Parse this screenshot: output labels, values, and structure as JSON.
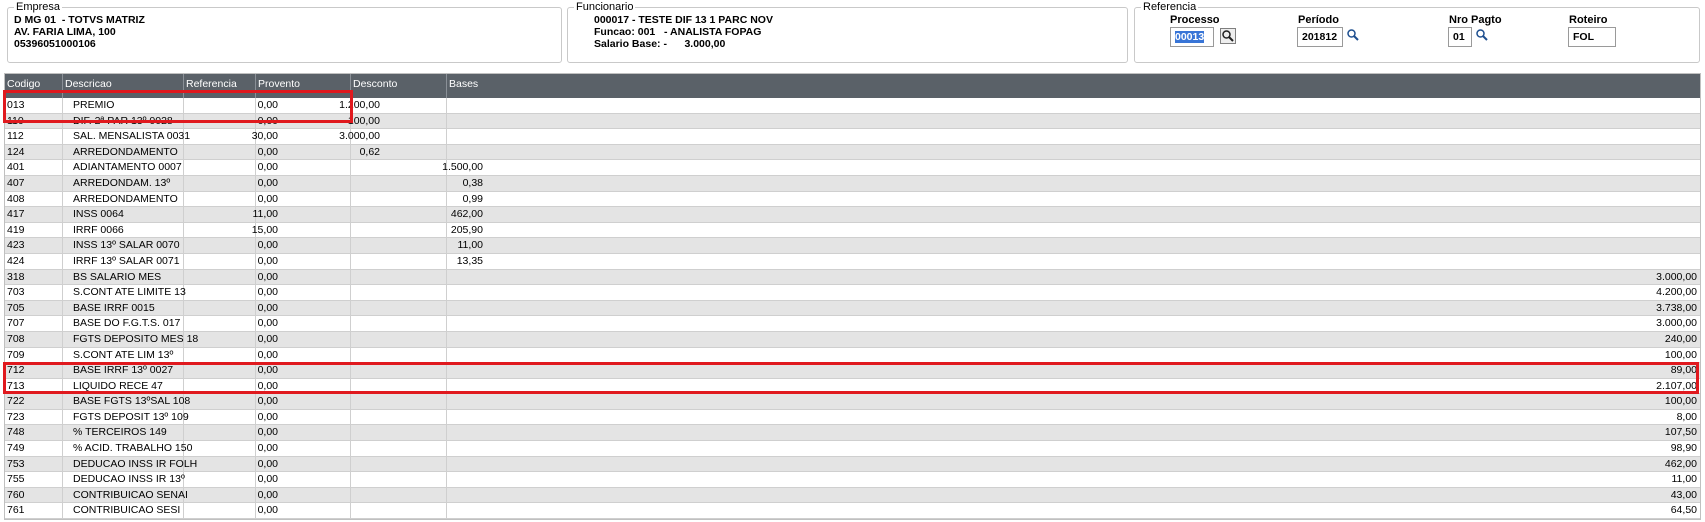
{
  "empresa": {
    "title": "Empresa",
    "line1": "D MG 01  - TOTVS MATRIZ",
    "line2": "AV. FARIA LIMA, 100",
    "line3": "05396051000106"
  },
  "funcionario": {
    "title": "Funcionario",
    "line1": "000017 - TESTE DIF 13 1 PARC NOV",
    "line2": "Funcao: 001   - ANALISTA FOPAG",
    "line3": "Salario Base: -      3.000,00"
  },
  "referencia": {
    "title": "Referencia",
    "processo_label": "Processo",
    "processo_value": "00013",
    "periodo_label": "Período",
    "periodo_value": "201812",
    "nro_pagto_label": "Nro Pagto",
    "nro_pagto_value": "01",
    "roteiro_label": "Roteiro",
    "roteiro_value": "FOL"
  },
  "table": {
    "headers": [
      "Codigo",
      "Descricao",
      "Referencia",
      "Provento",
      "Desconto",
      "Bases"
    ],
    "rows": [
      {
        "codigo": "013",
        "descricao": "PREMIO",
        "referencia": "0,00",
        "provento": "1.200,00",
        "desconto": "",
        "bases": ""
      },
      {
        "codigo": "110",
        "descricao": "DIF. 2ª PAR 13º 0028",
        "referencia": "0,00",
        "provento": "100,00",
        "desconto": "",
        "bases": ""
      },
      {
        "codigo": "112",
        "descricao": "SAL. MENSALISTA 0031",
        "referencia": "30,00",
        "provento": "3.000,00",
        "desconto": "",
        "bases": ""
      },
      {
        "codigo": "124",
        "descricao": "ARREDONDAMENTO",
        "referencia": "0,00",
        "provento": "0,62",
        "desconto": "",
        "bases": ""
      },
      {
        "codigo": "401",
        "descricao": "ADIANTAMENTO 0007",
        "referencia": "0,00",
        "provento": "",
        "desconto": "1.500,00",
        "bases": ""
      },
      {
        "codigo": "407",
        "descricao": "ARREDONDAM. 13º",
        "referencia": "0,00",
        "provento": "",
        "desconto": "0,38",
        "bases": ""
      },
      {
        "codigo": "408",
        "descricao": "ARREDONDAMENTO",
        "referencia": "0,00",
        "provento": "",
        "desconto": "0,99",
        "bases": ""
      },
      {
        "codigo": "417",
        "descricao": "INSS 0064",
        "referencia": "11,00",
        "provento": "",
        "desconto": "462,00",
        "bases": ""
      },
      {
        "codigo": "419",
        "descricao": "IRRF 0066",
        "referencia": "15,00",
        "provento": "",
        "desconto": "205,90",
        "bases": ""
      },
      {
        "codigo": "423",
        "descricao": "INSS 13º SALAR 0070",
        "referencia": "0,00",
        "provento": "",
        "desconto": "11,00",
        "bases": ""
      },
      {
        "codigo": "424",
        "descricao": "IRRF 13º SALAR 0071",
        "referencia": "0,00",
        "provento": "",
        "desconto": "13,35",
        "bases": ""
      },
      {
        "codigo": "318",
        "descricao": "BS SALARIO MES",
        "referencia": "0,00",
        "provento": "",
        "desconto": "",
        "bases": "3.000,00"
      },
      {
        "codigo": "703",
        "descricao": "S.CONT ATE LIMITE 13",
        "referencia": "0,00",
        "provento": "",
        "desconto": "",
        "bases": "4.200,00"
      },
      {
        "codigo": "705",
        "descricao": "BASE IRRF 0015",
        "referencia": "0,00",
        "provento": "",
        "desconto": "",
        "bases": "3.738,00"
      },
      {
        "codigo": "707",
        "descricao": "BASE DO F.G.T.S. 017",
        "referencia": "0,00",
        "provento": "",
        "desconto": "",
        "bases": "3.000,00"
      },
      {
        "codigo": "708",
        "descricao": "FGTS DEPOSITO MES 18",
        "referencia": "0,00",
        "provento": "",
        "desconto": "",
        "bases": "240,00"
      },
      {
        "codigo": "709",
        "descricao": "S.CONT ATE LIM 13º",
        "referencia": "0,00",
        "provento": "",
        "desconto": "",
        "bases": "100,00"
      },
      {
        "codigo": "712",
        "descricao": "BASE IRRF 13º 0027",
        "referencia": "0,00",
        "provento": "",
        "desconto": "",
        "bases": "89,00"
      },
      {
        "codigo": "713",
        "descricao": "LIQUIDO RECE 47",
        "referencia": "0,00",
        "provento": "",
        "desconto": "",
        "bases": "2.107,00"
      },
      {
        "codigo": "722",
        "descricao": "BASE FGTS 13ºSAL 108",
        "referencia": "0,00",
        "provento": "",
        "desconto": "",
        "bases": "100,00"
      },
      {
        "codigo": "723",
        "descricao": "FGTS DEPOSIT 13º 109",
        "referencia": "0,00",
        "provento": "",
        "desconto": "",
        "bases": "8,00"
      },
      {
        "codigo": "748",
        "descricao": "% TERCEIROS 149",
        "referencia": "0,00",
        "provento": "",
        "desconto": "",
        "bases": "107,50"
      },
      {
        "codigo": "749",
        "descricao": "% ACID. TRABALHO 150",
        "referencia": "0,00",
        "provento": "",
        "desconto": "",
        "bases": "98,90"
      },
      {
        "codigo": "753",
        "descricao": "DEDUCAO INSS IR FOLH",
        "referencia": "0,00",
        "provento": "",
        "desconto": "",
        "bases": "462,00"
      },
      {
        "codigo": "755",
        "descricao": "DEDUCAO INSS IR 13º",
        "referencia": "0,00",
        "provento": "",
        "desconto": "",
        "bases": "11,00"
      },
      {
        "codigo": "760",
        "descricao": "CONTRIBUICAO SENAI",
        "referencia": "0,00",
        "provento": "",
        "desconto": "",
        "bases": "43,00"
      },
      {
        "codigo": "761",
        "descricao": "CONTRIBUICAO SESI",
        "referencia": "0,00",
        "provento": "",
        "desconto": "",
        "bases": "64,50"
      }
    ]
  },
  "highlight_color": "#e0191e",
  "header_bg": "#5a6168",
  "row_alt_bg": "#e4e4e4"
}
